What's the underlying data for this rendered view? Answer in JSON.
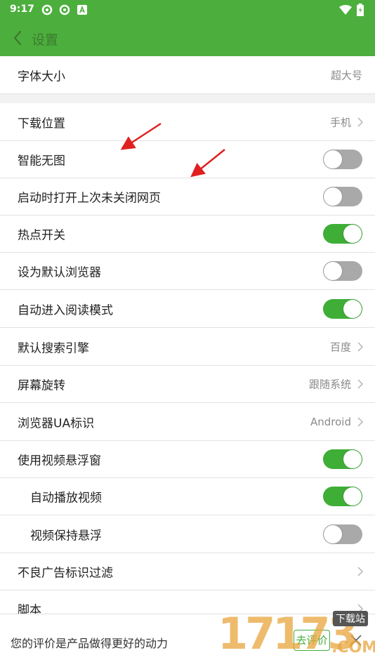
{
  "status_bar": {
    "time": "9:17"
  },
  "header": {
    "title": "设置"
  },
  "rows": [
    {
      "label": "字体大小",
      "value": "超大号",
      "kind": "value"
    },
    {
      "label": "下载位置",
      "value": "手机",
      "kind": "link"
    },
    {
      "label": "智能无图",
      "kind": "toggle",
      "on": false
    },
    {
      "label": "启动时打开上次未关闭网页",
      "kind": "toggle",
      "on": false
    },
    {
      "label": "热点开关",
      "kind": "toggle",
      "on": true
    },
    {
      "label": "设为默认浏览器",
      "kind": "toggle",
      "on": false
    },
    {
      "label": "自动进入阅读模式",
      "kind": "toggle",
      "on": true
    },
    {
      "label": "默认搜索引擎",
      "value": "百度",
      "kind": "link"
    },
    {
      "label": "屏幕旋转",
      "value": "跟随系统",
      "kind": "link"
    },
    {
      "label": "浏览器UA标识",
      "value": "Android",
      "kind": "link"
    },
    {
      "label": "使用视频悬浮窗",
      "kind": "toggle",
      "on": true
    },
    {
      "label": "自动播放视频",
      "kind": "toggle",
      "on": true
    },
    {
      "label": "视频保持悬浮",
      "kind": "toggle",
      "on": false
    },
    {
      "label": "不良广告标识过滤",
      "kind": "link"
    },
    {
      "label": "脚本",
      "kind": "link"
    }
  ],
  "bottom_bar": {
    "message": "您的评价是产品做得更好的动力",
    "rate_button": "去评价"
  },
  "watermark": {
    "digits": "17173",
    "tag": "下载站",
    "domain": ".COM"
  },
  "colors": {
    "accent": "#4caf3d",
    "toggle_on": "#3fae37",
    "toggle_off": "#a9a9a9",
    "annotation_arrow": "#e02020"
  }
}
